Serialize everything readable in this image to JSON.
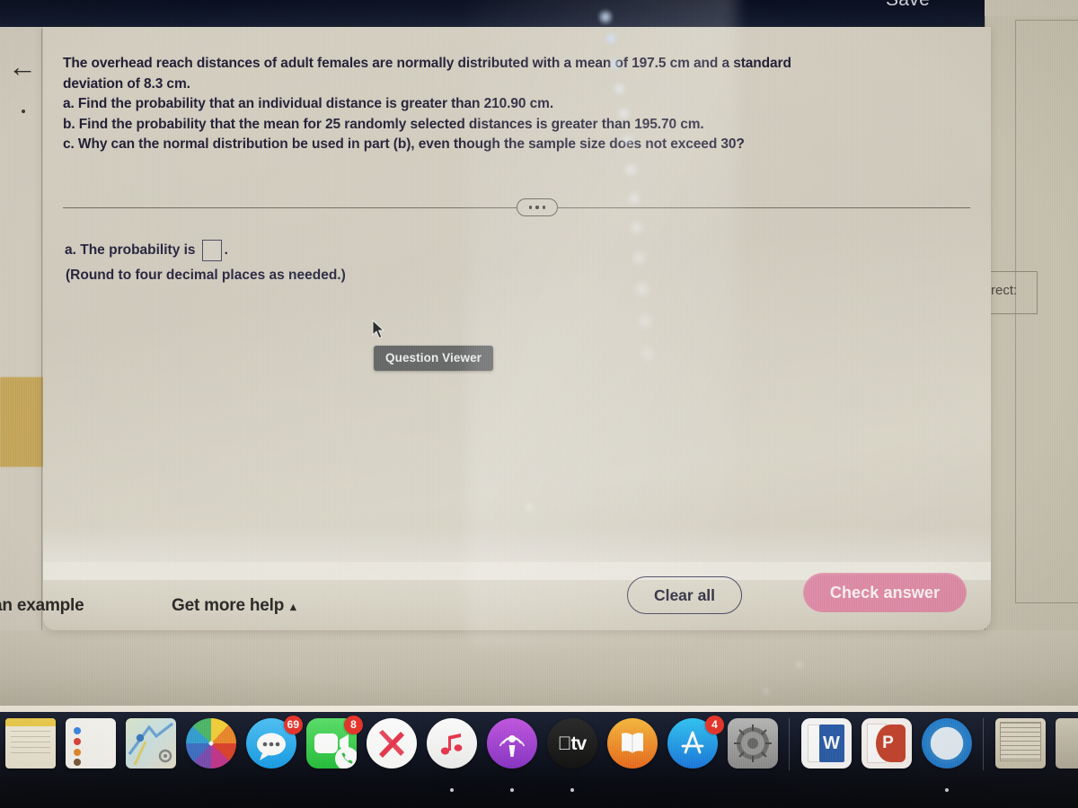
{
  "window": {
    "topbar": {
      "save_label": "Save"
    },
    "back_icon": "back-arrow-icon"
  },
  "background_window": {
    "clipped_label": "rect:"
  },
  "exercise": {
    "question": {
      "line1": "The overhead reach distances of adult females are normally distributed with a mean of 197.5 cm and a standard",
      "line2": "deviation of 8.3 cm.",
      "part_a": "a. Find the probability that an individual distance is greater than 210.90 cm.",
      "part_b": "b. Find the probability that the mean for 25 randomly selected distances is greater than 195.70 cm.",
      "part_c": "c. Why can the normal distribution be used in part (b), even though the sample size does not exceed 30?"
    },
    "divider": {
      "menu_icon": "ellipsis-icon",
      "dots": "•••"
    },
    "answer": {
      "prompt_label": "a. The probability is",
      "input_value": "",
      "input_placeholder": "",
      "period": ".",
      "rounding_hint": "(Round to four decimal places as needed.)"
    },
    "tooltip": {
      "text": "Question Viewer",
      "cursor_icon": "mouse-pointer-icon"
    },
    "footer": {
      "view_example_link": "an example",
      "get_more_help_link": "Get more help",
      "get_more_help_caret": "▴",
      "clear_all_button": "Clear all",
      "check_answer_button": "Check answer"
    },
    "colors": {
      "check_answer_bg": "#dc8ba5",
      "clear_all_border": "#4b4860",
      "answer_box_border": "#474463",
      "question_text": "#1f1d33",
      "dialog_bg": "#cdc8ba",
      "topbar_bg": "#0e1527",
      "tooltip_bg": "#5a5c5c",
      "amber_highlight": "#c19a3e"
    }
  },
  "dock": {
    "items": [
      {
        "name": "notes",
        "icon": "notes-icon",
        "badge": ""
      },
      {
        "name": "reminders",
        "icon": "reminders-icon",
        "badge": ""
      },
      {
        "name": "maps",
        "icon": "maps-icon",
        "badge": ""
      },
      {
        "name": "photos",
        "icon": "photos-icon",
        "badge": ""
      },
      {
        "name": "messages",
        "icon": "messages-icon",
        "badge": "69"
      },
      {
        "name": "facetime",
        "icon": "facetime-icon",
        "badge": "8"
      },
      {
        "name": "news",
        "icon": "news-icon",
        "badge": ""
      },
      {
        "name": "music",
        "icon": "music-icon",
        "badge": ""
      },
      {
        "name": "podcasts",
        "icon": "podcasts-icon",
        "badge": ""
      },
      {
        "name": "apple-tv",
        "icon": "apple-tv-icon",
        "badge": "",
        "label": "tv"
      },
      {
        "name": "books",
        "icon": "books-icon",
        "badge": ""
      },
      {
        "name": "app-store",
        "icon": "app-store-icon",
        "badge": "4"
      },
      {
        "name": "system-preferences",
        "icon": "gear-icon",
        "badge": ""
      },
      {
        "name": "microsoft-word",
        "icon": "word-icon",
        "badge": "",
        "label": "W"
      },
      {
        "name": "microsoft-powerpoint",
        "icon": "powerpoint-icon",
        "badge": "",
        "label": "P"
      },
      {
        "name": "safari",
        "icon": "compass-icon",
        "badge": ""
      },
      {
        "name": "preview-document",
        "icon": "document-icon",
        "badge": ""
      },
      {
        "name": "recent-document",
        "icon": "document-icon",
        "badge": ""
      }
    ]
  }
}
